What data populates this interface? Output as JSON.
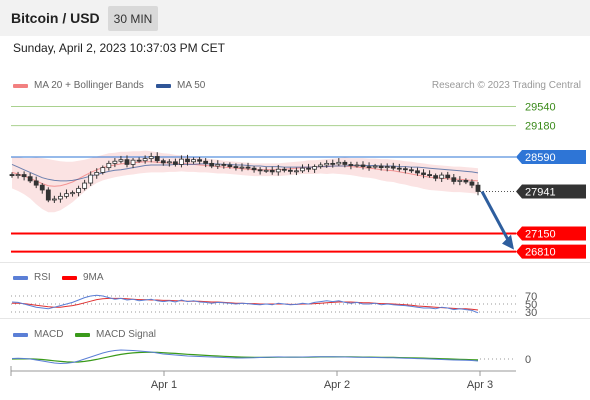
{
  "header": {
    "pair": "Bitcoin / USD",
    "timeframe": "30 MIN",
    "datetime": "Sunday, April 2, 2023 10:37:03 PM CET"
  },
  "legend": {
    "bb_label": "MA 20 + Bollinger Bands",
    "ma50_label": "MA 50",
    "credit": "Research © 2023 Trading Central",
    "rsi_label": "RSI",
    "rsi_ma_label": "9MA",
    "macd_label": "MACD",
    "macd_signal_label": "MACD Signal"
  },
  "colors": {
    "bb": "#f28080",
    "ma50": "#2f5597",
    "resistance": "#70ad47",
    "pivot": "#2e75d6",
    "support": "#ff0000",
    "price": "#333333",
    "arrow": "#2e5e9e",
    "rsi": "#5b7fd6",
    "macd_signal": "#3a9a1a"
  },
  "chart_data": [
    {
      "type": "candlestick",
      "title": "Bitcoin / USD",
      "x_ticks": [
        "Apr 1",
        "Apr 2",
        "Apr 3"
      ],
      "levels": [
        {
          "value": 29540,
          "label": "29540",
          "kind": "resistance"
        },
        {
          "value": 29180,
          "label": "29180",
          "kind": "resistance"
        },
        {
          "value": 28590,
          "label": "28590",
          "kind": "pivot"
        },
        {
          "value": 27941,
          "label": "27941",
          "kind": "last_price"
        },
        {
          "value": 27150,
          "label": "27150",
          "kind": "support"
        },
        {
          "value": 26810,
          "label": "26810",
          "kind": "support"
        }
      ],
      "close": [
        28240,
        28260,
        28220,
        28140,
        28060,
        27970,
        27780,
        27800,
        27850,
        27900,
        27920,
        28000,
        28100,
        28250,
        28300,
        28390,
        28470,
        28510,
        28540,
        28450,
        28530,
        28520,
        28560,
        28600,
        28520,
        28480,
        28500,
        28450,
        28550,
        28500,
        28540,
        28510,
        28470,
        28420,
        28450,
        28440,
        28410,
        28390,
        28400,
        28380,
        28350,
        28330,
        28340,
        28310,
        28360,
        28340,
        28320,
        28330,
        28380,
        28360,
        28410,
        28440,
        28470,
        28460,
        28490,
        28450,
        28430,
        28440,
        28410,
        28400,
        28420,
        28390,
        28410,
        28380,
        28370,
        28350,
        28330,
        28290,
        28260,
        28240,
        28190,
        28250,
        28200,
        28130,
        28150,
        28120,
        28060,
        27941
      ],
      "ma50": [
        28450,
        28400,
        28350,
        28300,
        28250,
        28200,
        28170,
        28150,
        28140,
        28140,
        28150,
        28170,
        28200,
        28230,
        28260,
        28290,
        28320,
        28340,
        28350,
        28370,
        28390,
        28410,
        28430,
        28440,
        28440,
        28440,
        28440,
        28450,
        28450,
        28450,
        28450,
        28460,
        28460,
        28460,
        28460,
        28450,
        28450,
        28440,
        28440,
        28430,
        28420,
        28420,
        28410,
        28410,
        28410,
        28400,
        28400,
        28400,
        28400,
        28400,
        28400,
        28410,
        28410,
        28420,
        28420,
        28420,
        28430,
        28430,
        28430,
        28430,
        28430,
        28420,
        28420,
        28420,
        28410,
        28410,
        28400,
        28400,
        28390,
        28380,
        28370,
        28360,
        28350,
        28340,
        28330,
        28320,
        28310,
        28290
      ],
      "bb_ma20": [
        28300,
        28270,
        28230,
        28190,
        28140,
        28090,
        28050,
        28040,
        28050,
        28080,
        28120,
        28180,
        28240,
        28300,
        28350,
        28390,
        28420,
        28440,
        28460,
        28470,
        28480,
        28490,
        28500,
        28500,
        28490,
        28480,
        28480,
        28470,
        28470,
        28460,
        28450,
        28440,
        28430,
        28420,
        28410,
        28400,
        28390,
        28380,
        28370,
        28360,
        28350,
        28350,
        28350,
        28350,
        28350,
        28360,
        28370,
        28380,
        28390,
        28400,
        28400,
        28410,
        28410,
        28420,
        28420,
        28420,
        28410,
        28400,
        28390,
        28380,
        28370,
        28350,
        28340,
        28330,
        28310,
        28290,
        28270,
        28250,
        28230,
        28210,
        28200,
        28190,
        28180,
        28170,
        28170,
        28160,
        28150,
        28140
      ],
      "bb_width": [
        300,
        320,
        340,
        380,
        440,
        480,
        500,
        490,
        460,
        420,
        380,
        340,
        300,
        270,
        250,
        240,
        240,
        230,
        230,
        220,
        220,
        210,
        210,
        200,
        190,
        180,
        170,
        160,
        150,
        150,
        140,
        140,
        130,
        130,
        130,
        120,
        120,
        120,
        120,
        120,
        120,
        120,
        120,
        120,
        120,
        120,
        120,
        120,
        120,
        130,
        130,
        130,
        140,
        140,
        150,
        160,
        160,
        170,
        180,
        180,
        190,
        200,
        210,
        210,
        220,
        220,
        230,
        230,
        240,
        240,
        240,
        240,
        240,
        240,
        240,
        240,
        240,
        240
      ]
    },
    {
      "type": "line",
      "series": [
        {
          "name": "RSI"
        },
        {
          "name": "9MA"
        }
      ],
      "y_ticks": [
        70,
        50,
        30
      ],
      "rsi": [
        55,
        54,
        50,
        46,
        42,
        40,
        38,
        42,
        46,
        50,
        54,
        60,
        66,
        70,
        72,
        70,
        66,
        62,
        64,
        60,
        62,
        58,
        60,
        62,
        58,
        56,
        58,
        55,
        60,
        56,
        58,
        55,
        54,
        52,
        54,
        53,
        52,
        50,
        52,
        51,
        49,
        48,
        50,
        48,
        52,
        50,
        48,
        49,
        52,
        50,
        54,
        56,
        58,
        56,
        58,
        54,
        52,
        54,
        50,
        50,
        52,
        48,
        50,
        48,
        47,
        46,
        44,
        42,
        40,
        40,
        38,
        42,
        40,
        36,
        38,
        36,
        34,
        28
      ],
      "rsi_ma": [
        52,
        52,
        51,
        49,
        47,
        45,
        43,
        42,
        42,
        44,
        46,
        49,
        53,
        57,
        61,
        63,
        64,
        64,
        64,
        63,
        62,
        61,
        61,
        60,
        60,
        59,
        59,
        58,
        58,
        57,
        57,
        57,
        56,
        55,
        55,
        54,
        53,
        52,
        52,
        51,
        51,
        50,
        50,
        50,
        50,
        50,
        49,
        49,
        50,
        50,
        51,
        52,
        53,
        54,
        55,
        55,
        55,
        54,
        53,
        53,
        52,
        51,
        51,
        50,
        49,
        48,
        47,
        45,
        44,
        43,
        42,
        41,
        40,
        39,
        38,
        38,
        37,
        35
      ]
    },
    {
      "type": "line",
      "series": [
        {
          "name": "MACD"
        },
        {
          "name": "MACD Signal"
        }
      ],
      "y_ticks": [
        0
      ],
      "macd": [
        10,
        14,
        10,
        0,
        -20,
        -40,
        -60,
        -80,
        -90,
        -85,
        -70,
        -40,
        0,
        40,
        80,
        120,
        150,
        170,
        180,
        175,
        170,
        160,
        150,
        140,
        120,
        100,
        90,
        80,
        70,
        60,
        55,
        50,
        45,
        40,
        35,
        30,
        25,
        20,
        20,
        22,
        25,
        30,
        35,
        40,
        42,
        40,
        38,
        38,
        40,
        42,
        45,
        46,
        45,
        44,
        43,
        40,
        38,
        36,
        34,
        32,
        30,
        28,
        26,
        24,
        20,
        16,
        12,
        8,
        4,
        0,
        -5,
        -10,
        -15,
        -20,
        -22,
        -25,
        -30,
        -40
      ],
      "signal": [
        0,
        2,
        4,
        3,
        -2,
        -10,
        -22,
        -35,
        -48,
        -58,
        -63,
        -60,
        -48,
        -30,
        -8,
        18,
        44,
        70,
        92,
        110,
        122,
        130,
        134,
        135,
        132,
        126,
        119,
        111,
        103,
        95,
        87,
        80,
        73,
        66,
        60,
        54,
        48,
        43,
        39,
        36,
        34,
        33,
        33,
        34,
        36,
        37,
        37,
        37,
        38,
        39,
        40,
        41,
        42,
        42,
        42,
        42,
        41,
        40,
        39,
        38,
        36,
        35,
        33,
        31,
        29,
        26,
        23,
        20,
        17,
        14,
        10,
        6,
        2,
        -2,
        -6,
        -10,
        -14,
        -18
      ]
    }
  ]
}
